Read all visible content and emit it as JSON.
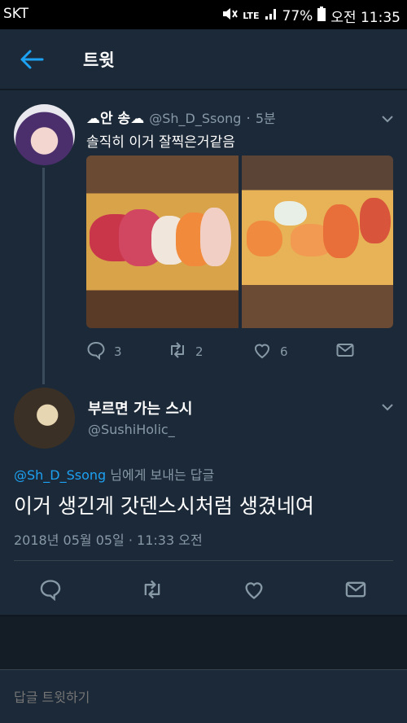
{
  "status": {
    "carrier": "SKT",
    "network": "LTE",
    "battery": "77%",
    "time": "오전 11:35"
  },
  "header": {
    "title": "트윗"
  },
  "tweet1": {
    "display_name": "☁안 송☁",
    "handle": "@Sh_D_Ssong",
    "time": "5분",
    "text": "솔직히 이거 잘찍은거같음",
    "replies": "3",
    "retweets": "2",
    "likes": "6"
  },
  "tweet2": {
    "display_name": "부르면 가는 스시",
    "handle": "@SushiHolic_",
    "reply_to_mention": "@Sh_D_Ssong",
    "reply_to_suffix": " 님에게 보내는 답글",
    "text": "이거 생긴게 갓덴스시처럼 생겼네여",
    "date": "2018년 05월 05일 · 11:33 오전"
  },
  "reply_bar": {
    "placeholder": "답글 트윗하기"
  },
  "colors": {
    "accent": "#1da1f2",
    "background": "#1c2938",
    "muted": "#8899a6"
  },
  "icons": [
    "back-arrow-icon",
    "chevron-down-icon",
    "reply-icon",
    "retweet-icon",
    "like-icon",
    "message-icon"
  ]
}
